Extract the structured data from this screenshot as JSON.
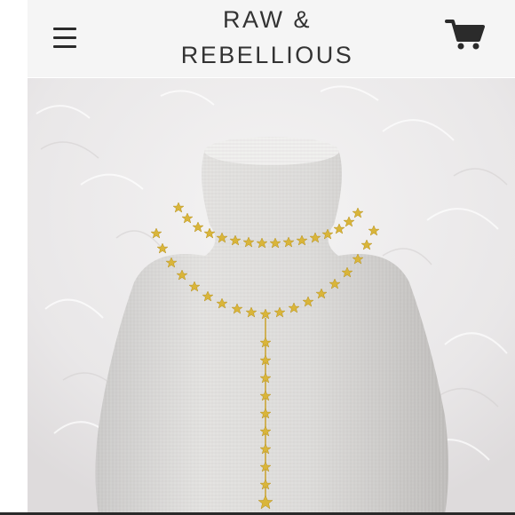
{
  "header": {
    "brand_line_1": "RAW &",
    "brand_line_2": "REBELLIOUS",
    "menu_icon": "hamburger-icon",
    "cart_icon": "cart-icon"
  },
  "colors": {
    "header_background": "#f5f5f5",
    "brand_text": "#333333",
    "icon": "#2b2b2b",
    "necklace_gold": "#d9b53a"
  },
  "product": {
    "image_subject": "gold star necklace on linen bust"
  }
}
